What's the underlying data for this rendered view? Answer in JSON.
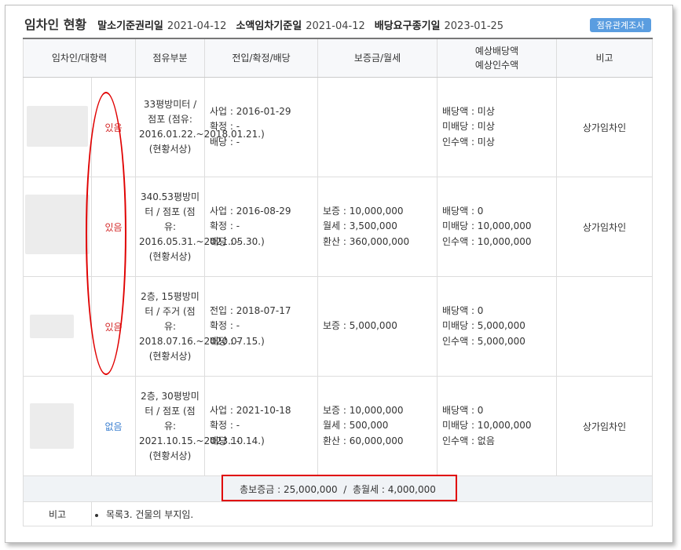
{
  "header": {
    "title": "임차인 현황",
    "meta": [
      {
        "label": "말소기준권리일",
        "value": "2021-04-12"
      },
      {
        "label": "소액임차기준일",
        "value": "2021-04-12"
      },
      {
        "label": "배당요구종기일",
        "value": "2023-01-25"
      }
    ],
    "button_label": "점유관계조사"
  },
  "columns": [
    "임차인/대항력",
    "점유부분",
    "전입/확정/배당",
    "보증금/월세",
    "예상배당액",
    "예상인수액",
    "비고"
  ],
  "rows": [
    {
      "opposing": "있음",
      "occupancy": "33평방미터 / 점포 (점유: 2016.01.22.~2018.01.21.) (현황서상)",
      "dates": [
        "사업 : 2016-01-29",
        "확정 : -",
        "배당 : -"
      ],
      "deposit": [],
      "dividend": [
        "배당액 : 미상",
        "미배당 : 미상",
        "인수액 : 미상"
      ],
      "note": "상가임차인"
    },
    {
      "opposing": "있음",
      "occupancy": "340.53평방미터 / 점포 (점유: 2016.05.31.~2021.05.30.) (현황서상)",
      "dates": [
        "사업 : 2016-08-29",
        "확정 : -",
        "배당 : -"
      ],
      "deposit": [
        "보증 : 10,000,000",
        "월세 : 3,500,000",
        "환산 : 360,000,000"
      ],
      "dividend": [
        "배당액 : 0",
        "미배당 : 10,000,000",
        "인수액 : 10,000,000"
      ],
      "note": "상가임차인"
    },
    {
      "opposing": "있음",
      "occupancy": "2층, 15평방미터 / 주거 (점유: 2018.07.16.~2020.07.15.) (현황서상)",
      "dates": [
        "전입 : 2018-07-17",
        "확정 : -",
        "배당 : -"
      ],
      "deposit": [
        "보증 : 5,000,000"
      ],
      "dividend": [
        "배당액 : 0",
        "미배당 : 5,000,000",
        "인수액 : 5,000,000"
      ],
      "note": ""
    },
    {
      "opposing": "없음",
      "occupancy": "2층, 30평방미터 / 점포 (점유: 2021.10.15.~2023.10.14.) (현황서상)",
      "dates": [
        "사업 : 2021-10-18",
        "확정 : -",
        "배당 : -"
      ],
      "deposit": [
        "보증 : 10,000,000",
        "월세 : 500,000",
        "환산 : 60,000,000"
      ],
      "dividend": [
        "배당액 : 0",
        "미배당 : 10,000,000",
        "인수액 : 없음"
      ],
      "note": "상가임차인"
    }
  ],
  "total": "총보증금 : 25,000,000  /  총월세 : 4,000,000",
  "remarks": {
    "label": "비고",
    "items": [
      "목록3. 건물의 부지임."
    ]
  },
  "colors": {
    "accent_button": "#5a9de0",
    "opposing_yes": "#d42b2b",
    "opposing_no": "#3b7fd0",
    "annotation": "#e00000"
  }
}
